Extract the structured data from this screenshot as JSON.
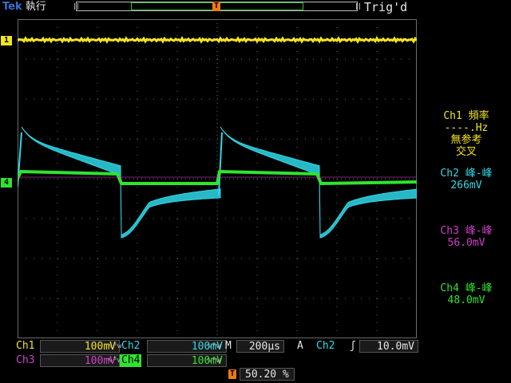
{
  "header": {
    "brand": "Tek",
    "acq_state": "執行",
    "trigger_status": "Trig'd",
    "trigger_marker": "T"
  },
  "channel_markers": {
    "ch1": "1",
    "ch4": "4"
  },
  "colors": {
    "ch1": "#f2e51f",
    "ch2": "#2fd8e8",
    "ch3": "#d23fc8",
    "ch4": "#2fe42f",
    "trigger": "#f07a10",
    "grid": "#6a6a6a"
  },
  "measurements": [
    {
      "title": "Ch1 頻率",
      "value": "----.Hz",
      "note": "無参考",
      "note2": "交叉",
      "color_key": "ch1"
    },
    {
      "title": "Ch2 峰-峰",
      "value": "266mV",
      "color_key": "ch2"
    },
    {
      "title": "Ch3 峰-峰",
      "value": "56.0mV",
      "color_key": "ch3"
    },
    {
      "title": "Ch4 峰-峰",
      "value": "48.0mV",
      "color_key": "ch4"
    }
  ],
  "bottom": {
    "ch1": {
      "label": "Ch1",
      "scale": "100mV"
    },
    "ch2": {
      "label": "Ch2",
      "scale": "100mV"
    },
    "ch3": {
      "label": "Ch3",
      "scale": "100mV"
    },
    "ch4": {
      "label": "Ch4",
      "scale": "100mV"
    },
    "bw_icon_glyph": "∿ᴮw",
    "timebase_prefix": "M",
    "timebase": "200µs",
    "trigger_mode": "A",
    "trigger_source": "Ch2",
    "trigger_slope_glyph": "ʃ",
    "trigger_level": "10.0mV",
    "horizontal_position": "50.20 %"
  }
}
